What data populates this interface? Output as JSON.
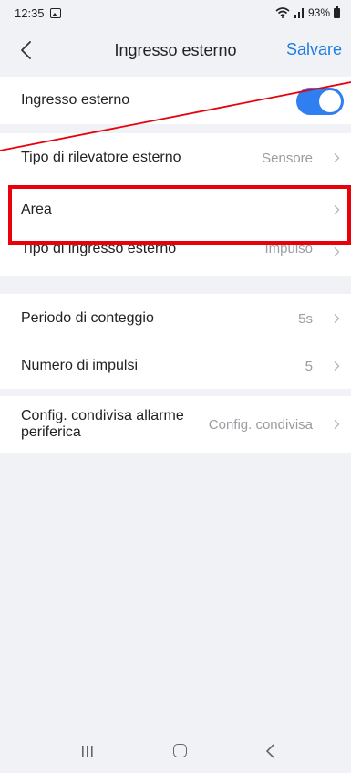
{
  "status_bar": {
    "time": "12:35",
    "battery": "93%"
  },
  "header": {
    "title": "Ingresso esterno",
    "save_label": "Salvare"
  },
  "toggle_section": {
    "label": "Ingresso esterno",
    "enabled": true,
    "accent_color": "#2f7ff0"
  },
  "detector_section": {
    "rows": [
      {
        "label": "Tipo di rilevatore esterno",
        "value": "Sensore"
      },
      {
        "label": "Area",
        "value": ""
      },
      {
        "label": "Tipo di ingresso esterno",
        "value": "Impulso"
      }
    ]
  },
  "pulse_section": {
    "rows": [
      {
        "label": "Periodo di conteggio",
        "value": "5s"
      },
      {
        "label": "Numero di impulsi",
        "value": "5"
      }
    ]
  },
  "shared_section": {
    "label_line1": "Config. condivisa allarme",
    "label_line2": "periferica",
    "value": "Config. condivisa"
  },
  "annotation": {
    "highlight_color": "#e8000b"
  }
}
